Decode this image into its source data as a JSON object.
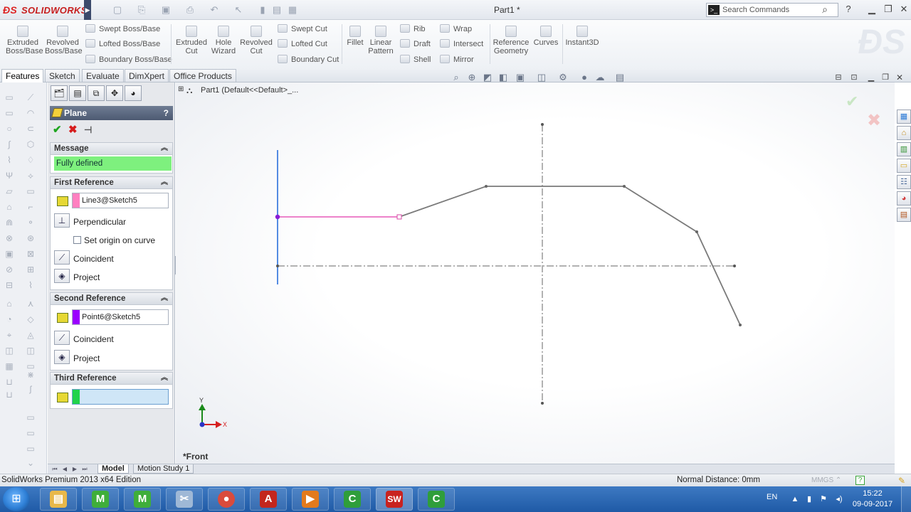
{
  "app": {
    "logo_text": "SOLIDWORKS",
    "document_title": "Part1 *",
    "search_placeholder": "Search Commands",
    "help_glyph": "?",
    "version_text": "SolidWorks Premium 2013 x64 Edition"
  },
  "ribbon": {
    "big_buttons": [
      {
        "label": "Extruded\nBoss/Base",
        "icon": "extruded-boss-icon"
      },
      {
        "label": "Revolved\nBoss/Base",
        "icon": "revolved-boss-icon"
      },
      {
        "label": "Extruded\nCut",
        "icon": "extruded-cut-icon"
      },
      {
        "label": "Hole\nWizard",
        "icon": "hole-wizard-icon"
      },
      {
        "label": "Revolved\nCut",
        "icon": "revolved-cut-icon"
      },
      {
        "label": "Fillet",
        "icon": "fillet-icon"
      },
      {
        "label": "Linear\nPattern",
        "icon": "linear-pattern-icon"
      },
      {
        "label": "Reference\nGeometry",
        "icon": "reference-geometry-icon"
      },
      {
        "label": "Curves",
        "icon": "curves-icon"
      },
      {
        "label": "Instant3D",
        "icon": "instant3d-icon"
      }
    ],
    "small_buttons": {
      "swept_boss": "Swept Boss/Base",
      "lofted_boss": "Lofted Boss/Base",
      "boundary_boss": "Boundary Boss/Base",
      "swept_cut": "Swept Cut",
      "lofted_cut": "Lofted Cut",
      "boundary_cut": "Boundary Cut",
      "rib": "Rib",
      "draft": "Draft",
      "shell": "Shell",
      "wrap": "Wrap",
      "intersect": "Intersect",
      "mirror": "Mirror"
    }
  },
  "tabs": [
    "Features",
    "Sketch",
    "Evaluate",
    "DimXpert",
    "Office Products"
  ],
  "active_tab": "Features",
  "property_manager": {
    "title": "Plane",
    "help": "?",
    "message_header": "Message",
    "message": "Fully defined",
    "first_reference": {
      "header": "First Reference",
      "value": "Line3@Sketch5",
      "swatch_color": "#ff80c0",
      "options": [
        "Perpendicular",
        "Coincident",
        "Project"
      ],
      "checkbox_label": "Set origin on curve",
      "checkbox_checked": false
    },
    "second_reference": {
      "header": "Second Reference",
      "value": "Point6@Sketch5",
      "swatch_color": "#9b00ff",
      "options": [
        "Coincident",
        "Project"
      ]
    },
    "third_reference": {
      "header": "Third Reference",
      "value": "",
      "swatch_color": "#22d34a"
    }
  },
  "graphics": {
    "tree_root": "Part1  (Default<<Default>_...",
    "view_label": "*Front",
    "triad_x": "X",
    "triad_y": "Y"
  },
  "bottom_tabs": [
    "Model",
    "Motion Study 1"
  ],
  "status": {
    "normal_distance": "Normal Distance: 0mm",
    "units": "MMGS"
  },
  "taskbar": {
    "apps": [
      {
        "name": "file-explorer",
        "glyph": "▤",
        "color": "#e8b84a"
      },
      {
        "name": "mendeley-1",
        "glyph": "M",
        "color": "#3fae3a"
      },
      {
        "name": "mendeley-2",
        "glyph": "M",
        "color": "#3fae3a"
      },
      {
        "name": "snipping-tool",
        "glyph": "✂",
        "color": "#9fb8d6"
      },
      {
        "name": "chrome",
        "glyph": "●",
        "color": "#d94b3c"
      },
      {
        "name": "acrobat",
        "glyph": "A",
        "color": "#c3261d"
      },
      {
        "name": "media-player",
        "glyph": "▶",
        "color": "#e37a1c"
      },
      {
        "name": "camtasia-1",
        "glyph": "C",
        "color": "#2f9e3b"
      },
      {
        "name": "solidworks",
        "glyph": "SW",
        "color": "#c9221f"
      },
      {
        "name": "camtasia-2",
        "glyph": "C",
        "color": "#2f9e3b"
      }
    ],
    "language": "EN",
    "time": "15:22",
    "date": "09-09-2017"
  }
}
